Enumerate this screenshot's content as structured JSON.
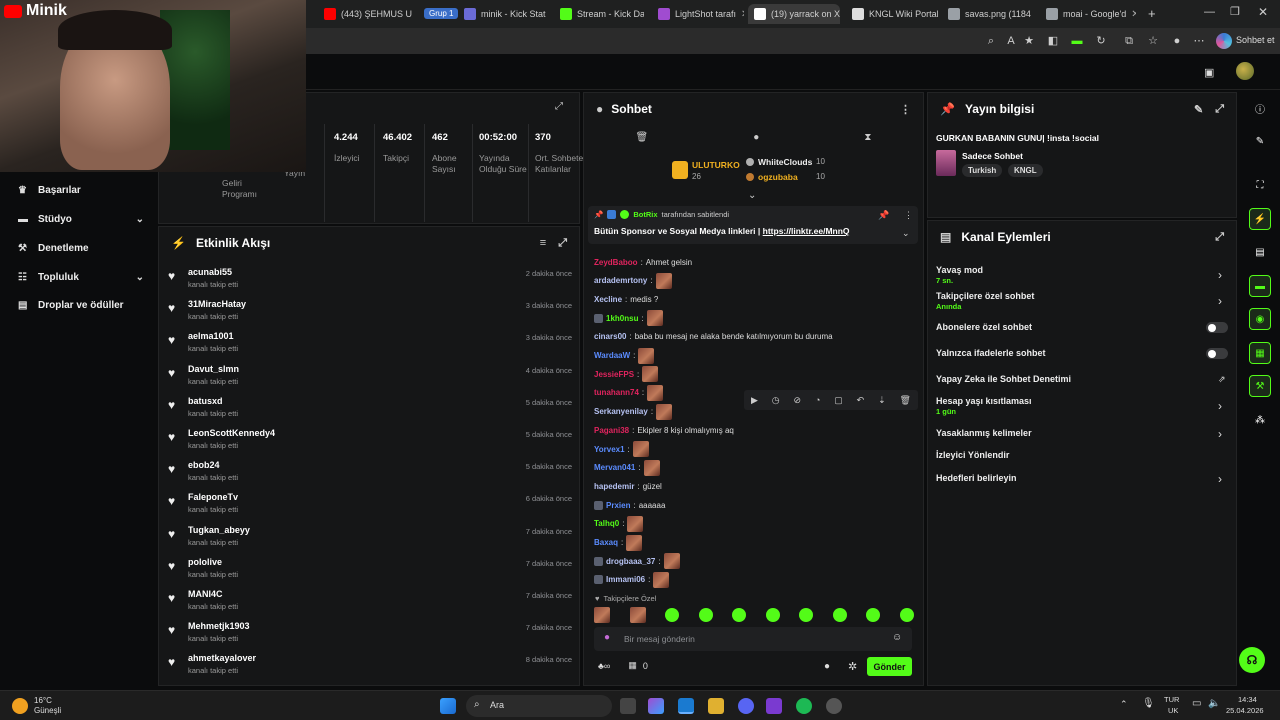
{
  "browser": {
    "tabs": [
      {
        "label": "(443) ŞEHMUS U",
        "color": "#ff0000"
      },
      {
        "label": "minik - Kick Stat",
        "color": "#6b6bd6"
      },
      {
        "label": "Stream - Kick Da",
        "color": "#53fc18"
      },
      {
        "label": "LightShot tarafı",
        "color": "#a04cd0"
      },
      {
        "label": "(19) yarrack on X",
        "color": "#ffffff"
      },
      {
        "label": "KNGL Wiki Portal",
        "color": "#dddddd"
      },
      {
        "label": "savas.png (1184",
        "color": "#9aa0a6"
      },
      {
        "label": "moai - Google'd",
        "color": "#9aa0a6"
      }
    ],
    "group_label": "Grup 1",
    "chat_button": "Sohbet et"
  },
  "webcam": {
    "title": "Minik"
  },
  "stats": {
    "items": [
      {
        "value": "4.244",
        "label": "İzleyici"
      },
      {
        "value": "46.402",
        "label": "Takipçi"
      },
      {
        "value": "462",
        "label": "Abone Sayısı"
      },
      {
        "value": "00:52:00",
        "label": "Yayında Olduğu Süre"
      },
      {
        "value": "370",
        "label": "Ort. Sohbete Katılanlar"
      }
    ],
    "partial_labels": [
      "Geliri Programı",
      "Yayın"
    ]
  },
  "sidebar": {
    "items": [
      {
        "label": "Başarılar",
        "icon": "trophy-icon",
        "chevron": false
      },
      {
        "label": "Stüdyo",
        "icon": "studio-icon",
        "chevron": true
      },
      {
        "label": "Denetleme",
        "icon": "hammer-icon",
        "chevron": false
      },
      {
        "label": "Topluluk",
        "icon": "community-icon",
        "chevron": true
      },
      {
        "label": "Droplar ve ödüller",
        "icon": "gift-icon",
        "chevron": false
      }
    ]
  },
  "activity": {
    "title": "Etkinlik Akışı",
    "sub": "kanalı takip etti",
    "items": [
      {
        "name": "acunabi55",
        "time": "2 dakika önce"
      },
      {
        "name": "31MiracHatay",
        "time": "3 dakika önce"
      },
      {
        "name": "aelma1001",
        "time": "3 dakika önce"
      },
      {
        "name": "Davut_slmn",
        "time": "4 dakika önce"
      },
      {
        "name": "batusxd",
        "time": "5 dakika önce"
      },
      {
        "name": "LeonScottKennedy4",
        "time": "5 dakika önce"
      },
      {
        "name": "ebob24",
        "time": "5 dakika önce"
      },
      {
        "name": "FaleponeTv",
        "time": "6 dakika önce"
      },
      {
        "name": "Tugkan_abeyy",
        "time": "7 dakika önce"
      },
      {
        "name": "pololive",
        "time": "7 dakika önce"
      },
      {
        "name": "MANI4C",
        "time": "7 dakika önce"
      },
      {
        "name": "Mehmetjk1903",
        "time": "7 dakika önce"
      },
      {
        "name": "ahmetkayalover",
        "time": "8 dakika önce"
      }
    ]
  },
  "chat": {
    "title": "Sohbet",
    "leaderboard": [
      {
        "name": "ULUTURKO",
        "count": "26"
      },
      {
        "name": "WhiiteClouds",
        "count": "10"
      },
      {
        "name": "ogzubaba",
        "count": "10"
      }
    ],
    "pinned_by": "BotRix",
    "pinned_suffix": "tarafından sabitlendi",
    "pinned_text": "Bütün Sponsor ve Sosyal Medya linkleri |",
    "pinned_link": "https://linktr.ee/MnnQ",
    "messages": [
      {
        "user": "ZeydBaboo",
        "color": "#e0245e",
        "text": "Ahmet gelsin",
        "emote": false,
        "badge": false
      },
      {
        "user": "ardademrtony",
        "color": "#b6c2f2",
        "text": "",
        "emote": true,
        "badge": false
      },
      {
        "user": "Xecline",
        "color": "#b6c2f2",
        "text": "medis ?",
        "emote": false,
        "badge": false
      },
      {
        "user": "1kh0nsu",
        "color": "#53fc18",
        "text": "",
        "emote": true,
        "badge": true
      },
      {
        "user": "cinars00",
        "color": "#b6c2f2",
        "text": "baba bu mesaj ne alaka bende katılmıyorum bu duruma",
        "emote": false,
        "badge": false
      },
      {
        "user": "WardaaW",
        "color": "#5b8cff",
        "text": "",
        "emote": true,
        "badge": false
      },
      {
        "user": "JessieFPS",
        "color": "#e0245e",
        "text": "",
        "emote": true,
        "badge": false
      },
      {
        "user": "tunahann74",
        "color": "#e0245e",
        "text": "",
        "emote": true,
        "badge": false
      },
      {
        "user": "Serkanyenilay",
        "color": "#b6c2f2",
        "text": "",
        "emote": true,
        "badge": false
      },
      {
        "user": "Pagani38",
        "color": "#e0245e",
        "text": "Ekipler 8 kişi olmalıymış aq",
        "emote": false,
        "badge": false
      },
      {
        "user": "Yorvex1",
        "color": "#5b8cff",
        "text": "",
        "emote": true,
        "badge": false
      },
      {
        "user": "Mervan041",
        "color": "#5b8cff",
        "text": "",
        "emote": true,
        "badge": false
      },
      {
        "user": "hapedemir",
        "color": "#b6c2f2",
        "text": "güzel",
        "emote": false,
        "badge": false
      },
      {
        "user": "Prxien",
        "color": "#5b8cff",
        "text": "aaaaaa",
        "emote": false,
        "badge": true
      },
      {
        "user": "Talhq0",
        "color": "#53fc18",
        "text": "",
        "emote": true,
        "badge": false
      },
      {
        "user": "Baxaq",
        "color": "#5b8cff",
        "text": "",
        "emote": true,
        "badge": false
      },
      {
        "user": "drogbaaa_37",
        "color": "#b6c2f2",
        "text": "",
        "emote": true,
        "badge": true
      },
      {
        "user": "Immami06",
        "color": "#b6c2f2",
        "text": "",
        "emote": true,
        "badge": true
      }
    ],
    "followers_only": "Takipçilere Özel",
    "input_placeholder": "Bir mesaj gönderin",
    "points": "0",
    "send_label": "Gönder"
  },
  "stream_info": {
    "title": "Yayın bilgisi",
    "stream_title": "GURKAN BABANIN GUNU| !insta !social",
    "category": "Sadece Sohbet",
    "tags": [
      "Turkish",
      "KNGL"
    ]
  },
  "channel_actions": {
    "title": "Kanal Eylemleri",
    "items": [
      {
        "label": "Yavaş mod",
        "sub": "7 sn.",
        "control": "chevron"
      },
      {
        "label": "Takipçilere özel sohbet",
        "sub": "Anında",
        "control": "chevron"
      },
      {
        "label": "Abonelere özel sohbet",
        "sub": "",
        "control": "toggle"
      },
      {
        "label": "Yalnızca ifadelerle sohbet",
        "sub": "",
        "control": "toggle"
      },
      {
        "label": "Yapay Zeka ile Sohbet Denetimi",
        "sub": "",
        "control": "external"
      },
      {
        "label": "Hesap yaşı kısıtlaması",
        "sub": "1 gün",
        "control": "chevron"
      },
      {
        "label": "Yasaklanmış kelimeler",
        "sub": "",
        "control": "chevron"
      },
      {
        "label": "İzleyici Yönlendir",
        "sub": "",
        "control": "none"
      },
      {
        "label": "Hedefleri belirleyin",
        "sub": "",
        "control": "chevron"
      }
    ]
  },
  "taskbar": {
    "weather_temp": "16°C",
    "weather_desc": "Güneşli",
    "search": "Ara",
    "lang1": "TUR",
    "lang2": "UK",
    "time": "14:34",
    "date": "25.04.2026"
  }
}
